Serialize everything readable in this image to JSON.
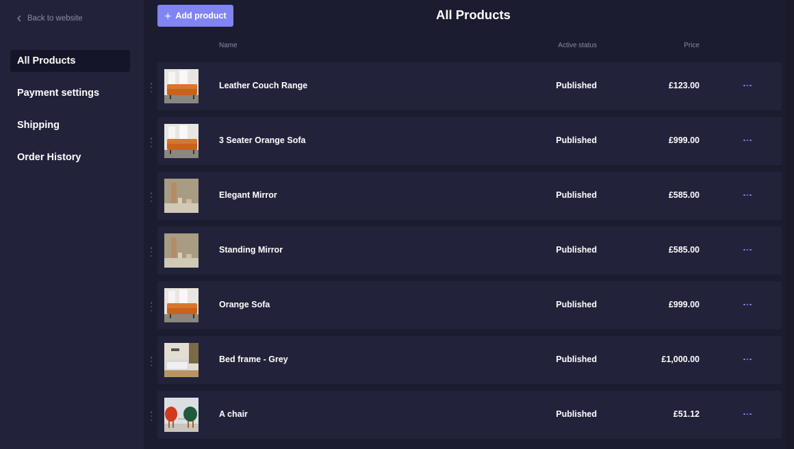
{
  "sidebar": {
    "back_link": {
      "label": "Back to website",
      "icon": "chevron-left-icon"
    },
    "items": [
      {
        "label": "All Products",
        "active": true
      },
      {
        "label": "Payment settings",
        "active": false
      },
      {
        "label": "Shipping",
        "active": false
      },
      {
        "label": "Order History",
        "active": false
      }
    ]
  },
  "header": {
    "add_button": {
      "label": "Add product",
      "icon": "plus-icon"
    },
    "title": "All Products"
  },
  "table": {
    "columns": {
      "name": "Name",
      "status": "Active status",
      "price": "Price"
    },
    "rows": [
      {
        "name": "Leather Couch Range",
        "status": "Published",
        "price": "£123.00",
        "image": "orange-sofa"
      },
      {
        "name": "3 Seater Orange Sofa",
        "status": "Published",
        "price": "£999.00",
        "image": "orange-sofa"
      },
      {
        "name": "Elegant Mirror",
        "status": "Published",
        "price": "£585.00",
        "image": "mirror"
      },
      {
        "name": "Standing Mirror",
        "status": "Published",
        "price": "£585.00",
        "image": "mirror"
      },
      {
        "name": "Orange Sofa",
        "status": "Published",
        "price": "£999.00",
        "image": "orange-sofa"
      },
      {
        "name": "Bed frame - Grey",
        "status": "Published",
        "price": "£1,000.00",
        "image": "bed"
      },
      {
        "name": "A chair",
        "status": "Published",
        "price": "£51.12",
        "image": "chairs"
      }
    ]
  },
  "colors": {
    "accent": "#8184f3",
    "background": "#1c1c31",
    "sidebar": "#22223b",
    "card": "#22223b",
    "active_nav": "#15152a",
    "muted_text": "#8a8aa6"
  }
}
